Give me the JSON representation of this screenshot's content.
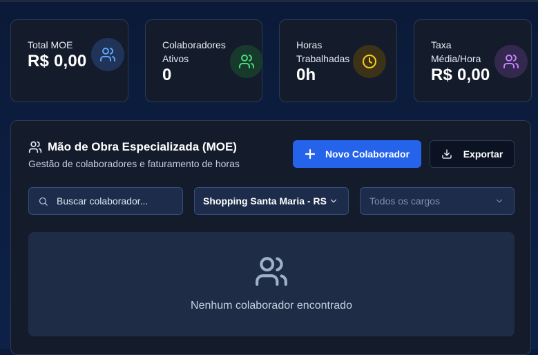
{
  "stats": [
    {
      "label_line1": "Total MOE",
      "label_line2": "",
      "value": "R$ 0,00",
      "icon": "users-icon",
      "icon_color": "#60a5fa",
      "icon_bg": "#1f3458"
    },
    {
      "label_line1": "Colaboradores",
      "label_line2": "Ativos",
      "value": "0",
      "icon": "users-icon",
      "icon_color": "#4ade80",
      "icon_bg": "#173a2c"
    },
    {
      "label_line1": "Horas",
      "label_line2": "Trabalhadas",
      "value": "0h",
      "icon": "clock-icon",
      "icon_color": "#facc15",
      "icon_bg": "#3b3218"
    },
    {
      "label_line1": "Taxa",
      "label_line2": "Média/Hora",
      "value": "R$ 0,00",
      "icon": "users-icon",
      "icon_color": "#c084fc",
      "icon_bg": "#35284f"
    }
  ],
  "panel": {
    "title": "Mão de Obra Especializada (MOE)",
    "subtitle": "Gestão de colaboradores e faturamento de horas",
    "new_button": "Novo Colaborador",
    "export_button": "Exportar"
  },
  "filters": {
    "search_placeholder": "Buscar colaborador...",
    "location_selected": "Shopping Santa Maria - RS",
    "role_selected": "Todos os cargos"
  },
  "empty_state": {
    "message": "Nenhum colaborador encontrado"
  }
}
